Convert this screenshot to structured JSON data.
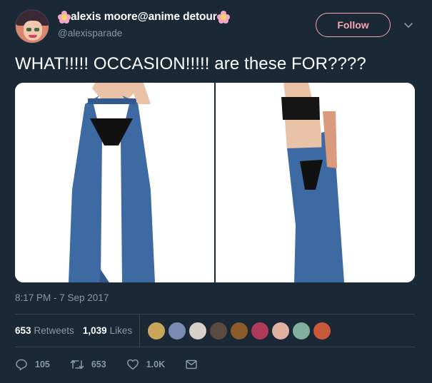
{
  "author": {
    "display_name": "alexis moore@anime detour",
    "handle": "@alexisparade"
  },
  "follow_label": "Follow",
  "tweet_text": "WHAT!!!!! OCCASION!!!!! are these FOR????",
  "timestamp": "8:17 PM - 7 Sep 2017",
  "stats": {
    "retweets_count": "653",
    "retweets_label": "Retweets",
    "likes_count": "1,039",
    "likes_label": "Likes"
  },
  "liker_avatars": [
    {
      "color": "#c9a45a"
    },
    {
      "color": "#7a8bb0"
    },
    {
      "color": "#d8d0c8"
    },
    {
      "color": "#5b4a40"
    },
    {
      "color": "#8a5a2b"
    },
    {
      "color": "#b03a5a"
    },
    {
      "color": "#e0b0a0"
    },
    {
      "color": "#7fb0a0"
    },
    {
      "color": "#c85a3a"
    }
  ],
  "actions": {
    "reply_count": "105",
    "retweet_count": "653",
    "like_count": "1.0K"
  },
  "colors": {
    "background": "#1b2836",
    "accent_pink": "#f4a7b0",
    "muted": "#8899a6"
  }
}
